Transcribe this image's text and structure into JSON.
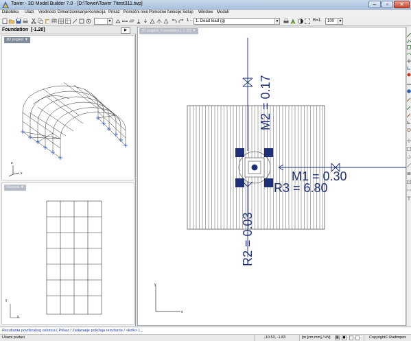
{
  "window": {
    "title": "Tower - 3D Model Builder 7.0 - [D:\\Tower\\Tower 7\\test311.twp]",
    "minimize_glyph": "–",
    "maximize_glyph": "▫",
    "close_glyph": "✕"
  },
  "menu": [
    "Datoteka",
    "Ulazi",
    "Vrednosti",
    "Dimenzionisanje",
    "Korekcija",
    "Prikaz",
    "Pomoćni nivo",
    "Pomoćne funkcije",
    "Setup",
    "Window",
    "Moduli"
  ],
  "toolbar": {
    "layer_value": "",
    "step_label": "1 -",
    "load_case": "1. Dead load (g)",
    "ratio_label": "R=1:",
    "ratio_value": "100"
  },
  "left_panel": {
    "title": "Foundation",
    "level": "[-1.20]",
    "button_glyph": "▶",
    "top_view_tag": "3D pogled",
    "bottom_view_tag": "Osnova",
    "axis_x": "x",
    "axis_y": "y",
    "axis_z": "z"
  },
  "main_view": {
    "tag": "3D pogled: Foundation [-1.20]",
    "labels": {
      "m2": "M2 = 0.17",
      "m1": "M1 = 0.30",
      "r3": "R3 = 6.80",
      "r2": "R2 = 0.03"
    },
    "axis_x": "x",
    "axis_y": "y",
    "load_color": "#1c2f78"
  },
  "command_line": "Rezultanta površinskog oslonca ( Prikaz / Zadavanje položaja rezultante / <kořk> ) _",
  "status_bar": {
    "left": "Ulazni podaci",
    "coords": "-10.53, -1.83",
    "units": "[m [cm,mm] / kN]",
    "copyright": "Copyright© Radimpex"
  },
  "icons": {
    "app": "tower-app-icon",
    "toolbar": [
      "new-file-icon",
      "open-file-icon",
      "save-icon",
      "print-icon",
      "cut-icon",
      "copy-icon",
      "paste-icon",
      "undo-icon",
      "redo-icon",
      "zoom-icon",
      "pan-icon",
      "rotate-icon",
      "visibility-icon",
      "settings-icon"
    ]
  }
}
